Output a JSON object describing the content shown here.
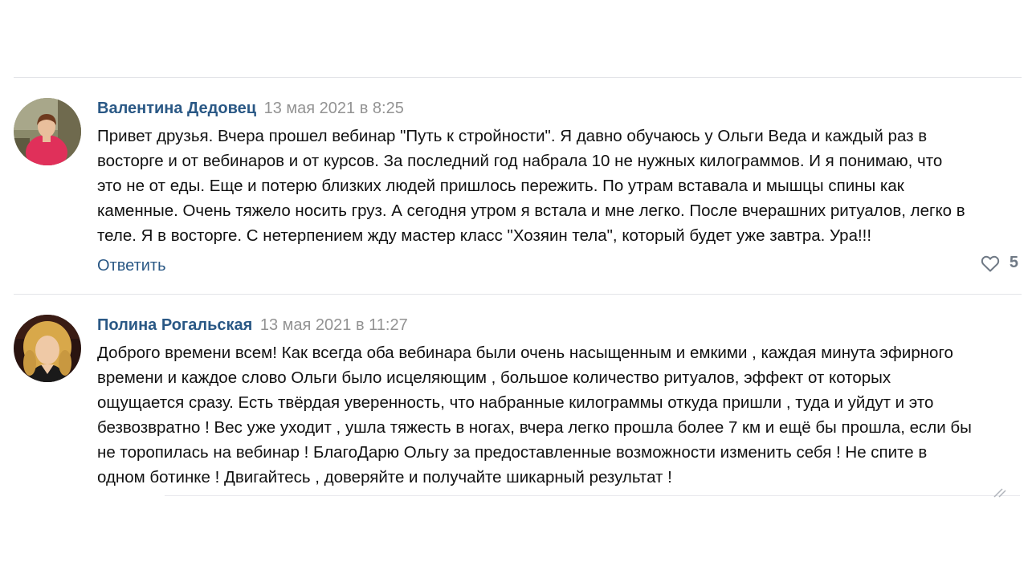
{
  "comments": [
    {
      "author": "Валентина Дедовец",
      "date": "13 мая 2021 в 8:25",
      "text": "Привет друзья. Вчера прошел вебинар \"Путь к стройности\". Я давно обучаюсь у Ольги Веда и каждый раз в\nвосторге и от вебинаров и от курсов. За последний год набрала 10 не нужных килограммов. И я понимаю, что\nэто не от еды. Еще и потерю близких людей пришлось пережить. По утрам вставала и мышцы спины как\nкаменные. Очень тяжело носить груз. А сегодня утром я встала и мне легко. После вчерашних ритуалов, легко в\nтеле. Я в восторге. С нетерпением жду мастер класс \"Хозяин тела\", который будет уже завтра. Ура!!!",
      "reply_label": "Ответить",
      "likes": "5"
    },
    {
      "author": "Полина Рогальская",
      "date": "13 мая 2021 в 11:27",
      "text": "Доброго времени всем! Как всегда оба вебинара были очень насыщенным и емкими , каждая минута эфирного\nвремени и каждое слово Ольги было исцеляющим , большое количество ритуалов, эффект от которых\nощущается сразу. Есть твёрдая уверенность, что набранные килограммы откуда пришли , туда и уйдут и это\nбезвозвратно ! Вес уже уходит , ушла тяжесть в ногах, вчера легко прошла более 7 км и ещё бы прошла, если бы\nне торопилась на вебинар ! БлагоДарю Ольгу за предоставленные возможности изменить себя ! Не спите в\nодном ботинке ! Двигайтесь , доверяйте и получайте шикарный результат !"
    }
  ],
  "icons": {
    "like": "heart-outline-icon",
    "resize": "resize-handle-icon"
  },
  "colors": {
    "link": "#2a5885",
    "meta": "#939393",
    "divider": "#e3e4e8",
    "like_icon": "#6f7985"
  }
}
